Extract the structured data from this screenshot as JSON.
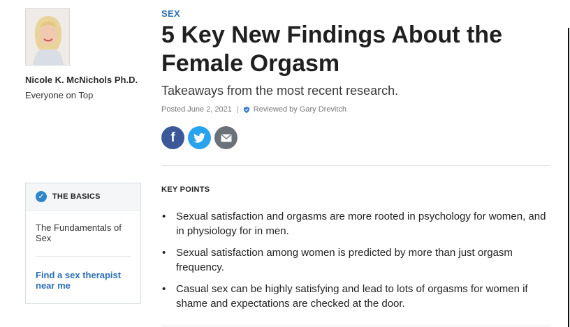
{
  "author": {
    "name": "Nicole K. McNichols Ph.D.",
    "blog": "Everyone on Top"
  },
  "basics": {
    "title": "THE BASICS",
    "link1": "The Fundamentals of Sex",
    "link2": "Find a sex therapist near me"
  },
  "article": {
    "category": "SEX",
    "headline": "5 Key New Findings About the Female Orgasm",
    "subtitle": "Takeaways from the most recent research.",
    "posted": "Posted June 2, 2021",
    "separator": "|",
    "reviewed": "Reviewed by Gary Drevitch"
  },
  "share": {
    "facebook_icon": "facebook-icon",
    "twitter_icon": "twitter-icon",
    "email_icon": "email-icon",
    "colors": {
      "facebook": "#3b5998",
      "twitter": "#2aa3ef",
      "email": "#6a7178"
    }
  },
  "key_points": {
    "title": "KEY POINTS",
    "items": [
      "Sexual satisfaction and orgasms are more rooted in psychology for women, and in physiology for in men.",
      "Sexual satisfaction among women is predicted by more than just orgasm frequency.",
      "Casual sex can be highly satisfying and lead to lots of orgasms for women if shame and expectations are checked at the door."
    ]
  },
  "accent_color": "#2a6fb6"
}
